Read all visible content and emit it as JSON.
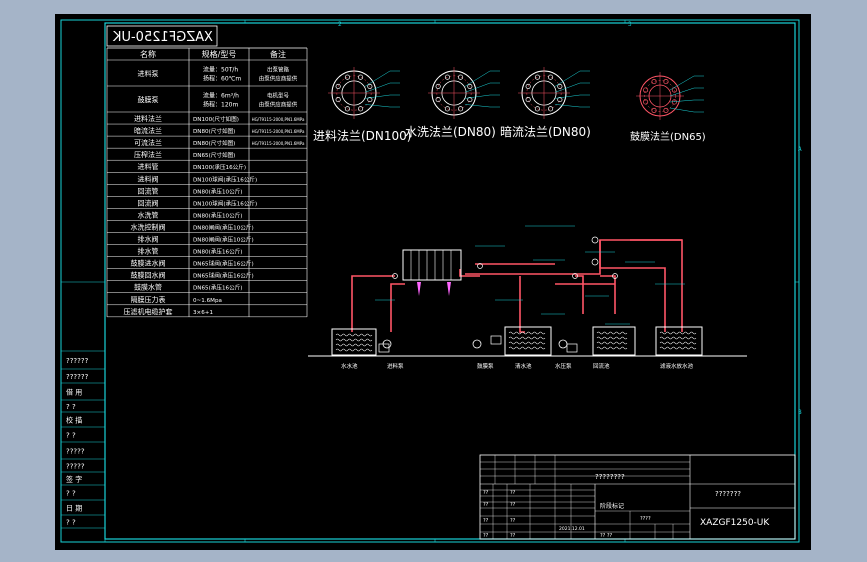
{
  "colors": {
    "frame": "#19d3d8",
    "text": "#ffffff",
    "pipe": "#ff5566",
    "label": "#19d3d8",
    "accent": "#ff66ff"
  },
  "stamp": "XAZGF1250-UK",
  "spec_table": {
    "headers": [
      "名称",
      "规格/型号",
      "备注"
    ],
    "rows": [
      {
        "name": "进料泵",
        "spec": "流量：50T/h\n扬程：60℃m",
        "note": "出泵管路\n由泵供应商提供"
      },
      {
        "name": "鼓膜泵",
        "spec": "流量：6m³/h\n扬程：120m",
        "note": "电机型号\n由泵供应商提供"
      },
      {
        "name": "进料法兰",
        "spec": "DN100(尺寸如图)",
        "note": "HG/T9115-2000,PN1.6MPa"
      },
      {
        "name": "暗流法兰",
        "spec": "DN80(尺寸如图)",
        "note": "HG/T9115-2000,PN1.6MPa"
      },
      {
        "name": "可流法兰",
        "spec": "DN80(尺寸如图)",
        "note": "HG/T9115-2000,PN1.6MPa"
      },
      {
        "name": "压榨法兰",
        "spec": "DN65(尺寸如图)",
        "note": ""
      },
      {
        "name": "进料管",
        "spec": "DN100(承压16公斤)",
        "note": ""
      },
      {
        "name": "进料阀",
        "spec": "DN100球阀(承压16公斤)",
        "note": ""
      },
      {
        "name": "回流管",
        "spec": "DN80(承压10公斤)",
        "note": ""
      },
      {
        "name": "回流阀",
        "spec": "DN100球阀(承压16公斤)",
        "note": ""
      },
      {
        "name": "水洗管",
        "spec": "DN80(承压10公斤)",
        "note": ""
      },
      {
        "name": "水洗控制阀",
        "spec": "DN80闸阀(承压10公斤)",
        "note": ""
      },
      {
        "name": "排水阀",
        "spec": "DN80闸阀(承压10公斤)",
        "note": ""
      },
      {
        "name": "排水管",
        "spec": "DN80(承压16公斤)",
        "note": ""
      },
      {
        "name": "鼓膜进水阀",
        "spec": "DN65球阀(承压16公斤)",
        "note": ""
      },
      {
        "name": "鼓膜回水阀",
        "spec": "DN65球阀(承压16公斤)",
        "note": ""
      },
      {
        "name": "鼓膜水管",
        "spec": "DN65(承压16公斤)",
        "note": ""
      },
      {
        "name": "隔膜压力表",
        "spec": "0~1.6Mpa",
        "note": ""
      },
      {
        "name": "压滤机电缆护套",
        "spec": "3×6+1",
        "note": ""
      }
    ]
  },
  "flanges": [
    {
      "label": "进料法兰(DN100)"
    },
    {
      "label": "水洗法兰(DN80)"
    },
    {
      "label": "暗流法兰(DN80)"
    },
    {
      "label": "鼓膜法兰(DN65)"
    }
  ],
  "tanks": [
    {
      "label": "水水池"
    },
    {
      "label": "进料泵"
    },
    {
      "label": "鼓膜泵"
    },
    {
      "label": "清水池"
    },
    {
      "label": "水压泵"
    },
    {
      "label": "回流池"
    },
    {
      "label": "滤液水放水池"
    }
  ],
  "side_strip": [
    "??????",
    "??????",
    "借 用",
    "? ?",
    "校 描",
    "? ?",
    "?????",
    "?????",
    "签 字",
    "? ?",
    "日 期",
    "? ?"
  ],
  "title_block": {
    "cell_top": "????????",
    "cell_right": "???????",
    "drawing_no": "XAZGF1250-UK",
    "small_labels": [
      "??",
      "??",
      "??",
      "??",
      "??",
      "??",
      "??",
      "??"
    ],
    "material_label": "阶段标记",
    "date": "2021.12.01",
    "sheet_labels": [
      "????",
      "?? ??"
    ]
  },
  "border_letters": [
    "A",
    "B",
    "C",
    "D",
    "1",
    "2",
    "3",
    "4"
  ]
}
